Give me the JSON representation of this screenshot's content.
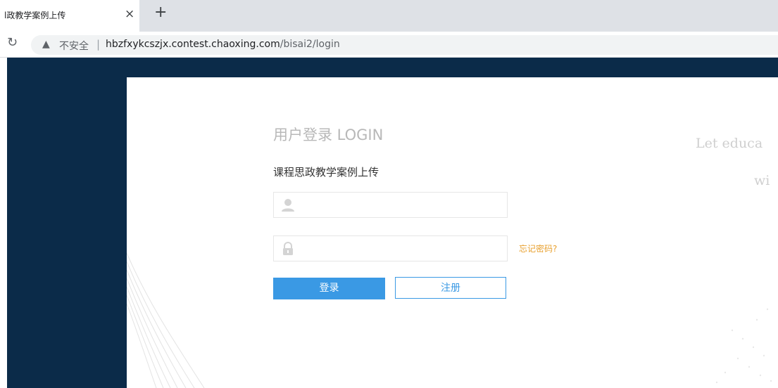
{
  "browser": {
    "tab_title": "l政教学案例上传",
    "tab_close": "×",
    "new_tab": "+",
    "reload_icon": "↻",
    "insecure_label": "不安全",
    "separator": "|",
    "url_host": "hbzfxykcszjx.contest.chaoxing.com",
    "url_path": "/bisai2/login"
  },
  "login": {
    "title": "用户登录 LOGIN",
    "subtitle": "课程思政教学案例上传",
    "username_value": "",
    "password_value": "",
    "forgot_label": "忘记密码?",
    "login_button": "登录",
    "register_button": "注册"
  },
  "decor": {
    "slogan_line1": "Let educa",
    "slogan_line2": "wi"
  },
  "colors": {
    "page_bg": "#0b2b49",
    "accent": "#3a99e4",
    "forgot": "#e8a02e"
  }
}
